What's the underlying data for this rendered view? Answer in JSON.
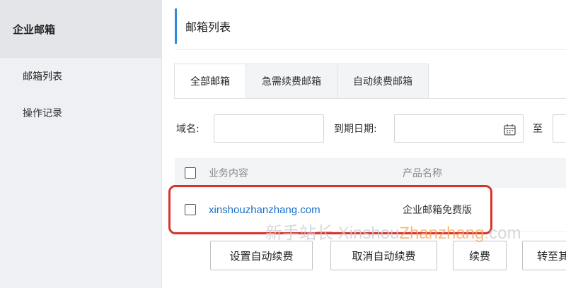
{
  "sidebar": {
    "title": "企业邮箱",
    "items": [
      {
        "label": "邮箱列表",
        "active": true
      },
      {
        "label": "操作记录",
        "active": false
      }
    ]
  },
  "header": {
    "title": "邮箱列表"
  },
  "tabs": [
    {
      "label": "全部邮箱",
      "active": true
    },
    {
      "label": "急需续费邮箱",
      "active": false
    },
    {
      "label": "自动续费邮箱",
      "active": false
    }
  ],
  "filters": {
    "domain_label": "域名:",
    "domain_value": "",
    "expiry_label": "到期日期:",
    "expiry_start": "",
    "to_label": "至",
    "expiry_end": ""
  },
  "table": {
    "columns": [
      "业务内容",
      "产品名称"
    ],
    "rows": [
      {
        "content": "xinshouzhanzhang.com",
        "product": "企业邮箱免费版"
      }
    ]
  },
  "actions": [
    "设置自动续费",
    "取消自动续费",
    "续费",
    "转至其"
  ],
  "watermark": {
    "prefix": "新手站长 Xinshou",
    "accent": "Zhanzhang",
    "suffix": ".com"
  },
  "colors": {
    "accent_blue": "#2f8cdd",
    "link": "#1a6fc8",
    "highlight": "#d9342b"
  }
}
